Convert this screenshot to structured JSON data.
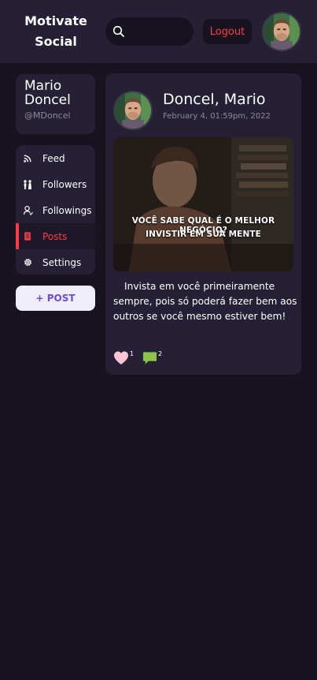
{
  "header": {
    "logo_line1": "Motivate",
    "logo_line2": "Social",
    "search_placeholder": "",
    "logout_label": "Logout"
  },
  "profile": {
    "first_name": "Mario",
    "last_name": "Doncel",
    "handle": "@MDoncel"
  },
  "nav": {
    "items": [
      {
        "label": "Feed",
        "icon": "rss-icon",
        "active": false
      },
      {
        "label": "Followers",
        "icon": "followers-icon",
        "active": false
      },
      {
        "label": "Followings",
        "icon": "user-icon",
        "active": false
      },
      {
        "label": "Posts",
        "icon": "document-icon",
        "active": true
      },
      {
        "label": "Settings",
        "icon": "gear-icon",
        "active": false
      }
    ]
  },
  "post_button_label": "+ POST",
  "post": {
    "author": "Doncel, Mario",
    "date": "February 4, 01:59pm, 2022",
    "image_caption_line1": "VOCÊ SABE QUAL É O MELHOR NEGÓCIO?",
    "image_caption_line2": "INVISTIR EM SUA MENTE",
    "text": "Invista em você primeiramente sempre, pois só poderá fazer bem aos outros se você mesmo estiver bem!",
    "likes": "1",
    "comments": "2"
  },
  "colors": {
    "background": "#17131f",
    "panel": "#252036",
    "accent_red": "#ff3b47",
    "accent_purple": "#6a4bd6",
    "like_pink": "#ffc4cf",
    "comment_green": "#8bc34a"
  }
}
